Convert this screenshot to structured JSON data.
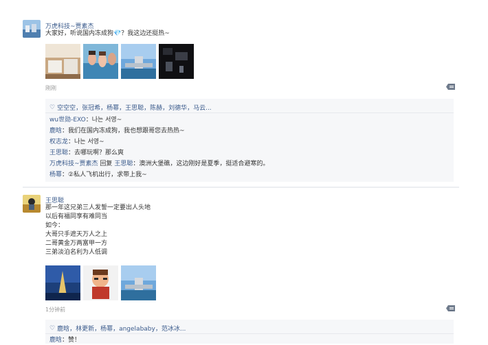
{
  "post1": {
    "author": "万虎科技~贾素杰",
    "text": "大家好，听说国内冻成狗💎？我这边还挺热~",
    "time": "刚刚",
    "likes": "空空空，张冠希，杨幂，王思聪，陈赫，刘德华，马云...",
    "comments": [
      {
        "user": "wu世勋-EXO",
        "sep": "：",
        "text": "나는 서영~"
      },
      {
        "user": "鹿晗",
        "sep": "：",
        "text": "我们在国内冻成狗，我也想跟哥您去热热~"
      },
      {
        "user": "权志龙",
        "sep": "：",
        "text": "나는 서영~"
      },
      {
        "user": "王思聪",
        "sep": "：",
        "text": "去哪玩啊？那么爽"
      },
      {
        "user": "万虎科技~贾素杰",
        "reply": "回复",
        "target": "王思聪",
        "sep": "：",
        "text": "澳洲大堡礁，这边刚好是夏季，挺适合避寒的。"
      },
      {
        "user": "杨幂",
        "sep": "：",
        "text": "②私人飞机出行，求带上我~"
      }
    ]
  },
  "post2": {
    "author": "王思聪",
    "lines": [
      "那一年这兄弟三人发誓一定要出人头地",
      "以后有福同享有难同当",
      "如今：",
      "大哥只手遮天万人之上",
      "二哥黄金万两富甲一方",
      "三弟淡泊名利为人低调"
    ],
    "time": "1分钟前",
    "likes": "鹿晗，林更新，杨幂，angelababy，范冰冰...",
    "comments": [
      {
        "user": "鹿晗",
        "sep": "：",
        "text": "赞！"
      }
    ]
  },
  "colors": {
    "link": "#3b5b8c",
    "bg_box": "#f6f7f9"
  }
}
